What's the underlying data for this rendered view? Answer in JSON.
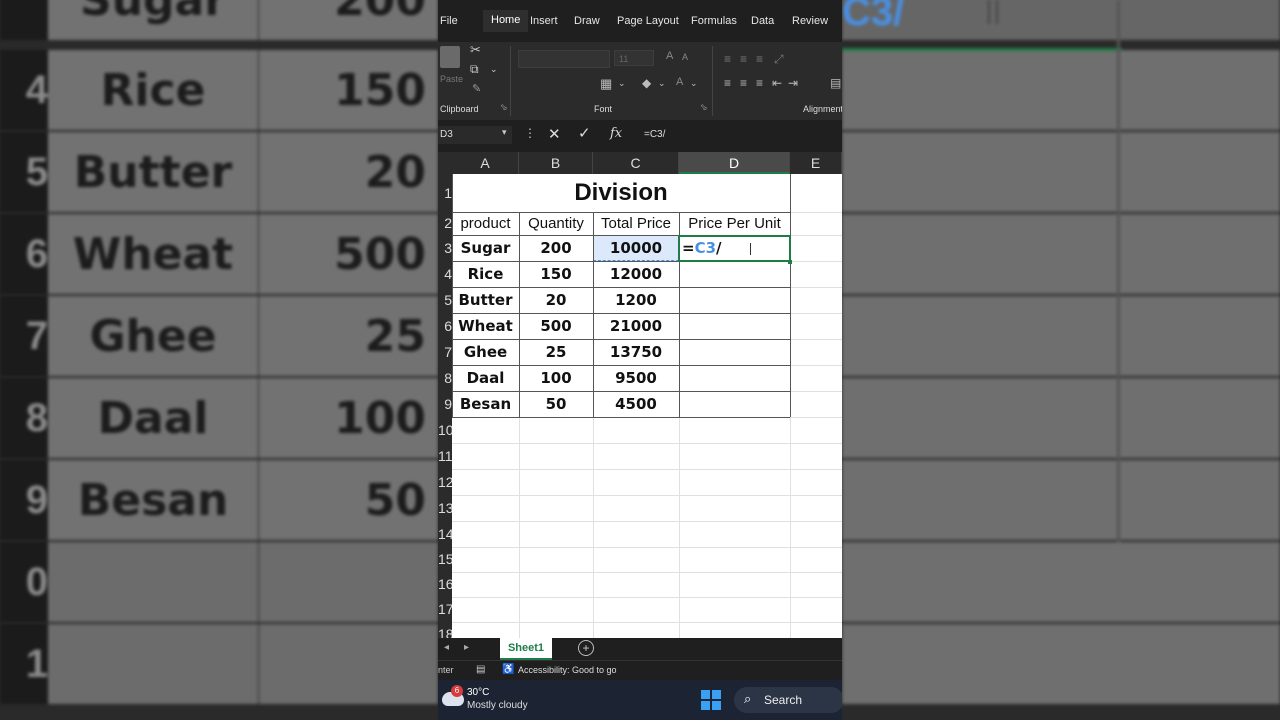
{
  "background": {
    "rows": [
      {
        "row": "",
        "product": "Sugar",
        "qty": "200"
      },
      {
        "row": "4",
        "product": "Rice",
        "qty": "150"
      },
      {
        "row": "5",
        "product": "Butter",
        "qty": "20"
      },
      {
        "row": "6",
        "product": "Wheat",
        "qty": "500"
      },
      {
        "row": "7",
        "product": "Ghee",
        "qty": "25"
      },
      {
        "row": "8",
        "product": "Daal",
        "qty": "100"
      },
      {
        "row": "9",
        "product": "Besan",
        "qty": "50"
      },
      {
        "row": "0",
        "product": "",
        "qty": ""
      },
      {
        "row": "1",
        "product": "",
        "qty": ""
      }
    ],
    "formula_fragment": "C3/"
  },
  "ribbon": {
    "tabs": [
      "File",
      "Home",
      "Insert",
      "Draw",
      "Page Layout",
      "Formulas",
      "Data",
      "Review"
    ],
    "active_tab": "Home",
    "groups": [
      "Clipboard",
      "Font",
      "Alignment"
    ],
    "paste_label": "Paste",
    "font_size": "11"
  },
  "formula_bar": {
    "name_box": "D3",
    "formula": "=C3/",
    "fx": "fx"
  },
  "columns": [
    "A",
    "B",
    "C",
    "D",
    "E"
  ],
  "selected_column": "D",
  "row_numbers": [
    "1",
    "2",
    "3",
    "4",
    "5",
    "6",
    "7",
    "8",
    "9",
    "10",
    "11",
    "12",
    "13",
    "14",
    "15",
    "16",
    "17",
    "18"
  ],
  "title": "Division",
  "headers": [
    "product",
    "Quantity",
    "Total Price",
    "Price Per Unit"
  ],
  "rows": [
    {
      "product": "Sugar",
      "qty": "200",
      "total": "10000"
    },
    {
      "product": "Rice",
      "qty": "150",
      "total": "12000"
    },
    {
      "product": "Butter",
      "qty": "20",
      "total": "1200"
    },
    {
      "product": "Wheat",
      "qty": "500",
      "total": "21000"
    },
    {
      "product": "Ghee",
      "qty": "25",
      "total": "13750"
    },
    {
      "product": "Daal",
      "qty": "100",
      "total": "9500"
    },
    {
      "product": "Besan",
      "qty": "50",
      "total": "4500"
    }
  ],
  "active_cell": {
    "eq": "=",
    "ref": "C3",
    "op": "/"
  },
  "sheet_tab": "Sheet1",
  "status": {
    "mode": "Enter",
    "accessibility": "Accessibility: Good to go"
  },
  "taskbar": {
    "badge": "6",
    "temperature": "30°C",
    "weather": "Mostly cloudy",
    "search": "Search"
  },
  "colors": {
    "accent_green": "#1e7d45",
    "ref_blue": "#4a90e2"
  }
}
